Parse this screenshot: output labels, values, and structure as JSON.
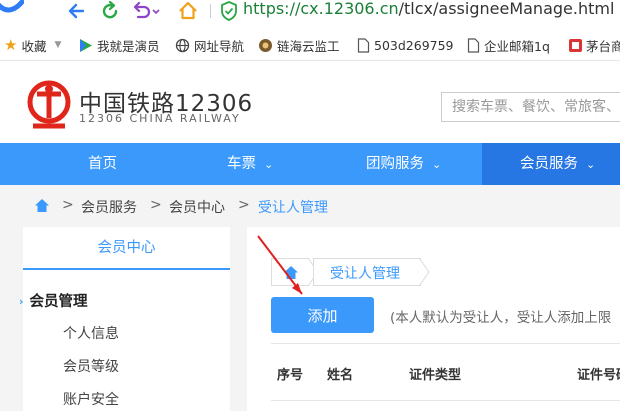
{
  "browser": {
    "url_host": "cx.12306.cn",
    "url_path": "/tlcx/assigneeManage.html",
    "url_scheme": "https://",
    "bookmarks": [
      {
        "label": "收藏",
        "icon": "star-icon"
      },
      {
        "label": "我就是演员",
        "icon": "play-icon"
      },
      {
        "label": "网址导航",
        "icon": "globe-icon"
      },
      {
        "label": "链海云监工",
        "icon": "site-icon"
      },
      {
        "label": "503d269759",
        "icon": "page-icon"
      },
      {
        "label": "企业邮箱1q",
        "icon": "page-icon"
      },
      {
        "label": "茅台商",
        "icon": "site-icon"
      }
    ]
  },
  "site": {
    "title": "中国铁路12306",
    "subtitle": "12306 CHINA RAILWAY",
    "search_placeholder": "搜索车票、餐饮、常旅客、"
  },
  "nav": {
    "items": [
      {
        "label": "首页",
        "has_dropdown": false
      },
      {
        "label": "车票",
        "has_dropdown": true
      },
      {
        "label": "团购服务",
        "has_dropdown": true
      },
      {
        "label": "会员服务",
        "has_dropdown": true
      }
    ],
    "active_index": 3
  },
  "breadcrumb": {
    "items": [
      "会员服务",
      "会员中心",
      "受让人管理"
    ],
    "separator": ">"
  },
  "sidebar": {
    "header": "会员中心",
    "group": "会员管理",
    "items": [
      "个人信息",
      "会员等级",
      "账户安全"
    ]
  },
  "content": {
    "tab_label": "受让人管理",
    "add_button": "添加",
    "note": "(本人默认为受让人，受让人添加上限",
    "table_headers": [
      "序号",
      "姓名",
      "证件类型",
      "证件号码"
    ]
  },
  "colors": {
    "accent": "#3b99fc",
    "nav_active": "#2676e3",
    "logo_red": "#e0251b"
  }
}
